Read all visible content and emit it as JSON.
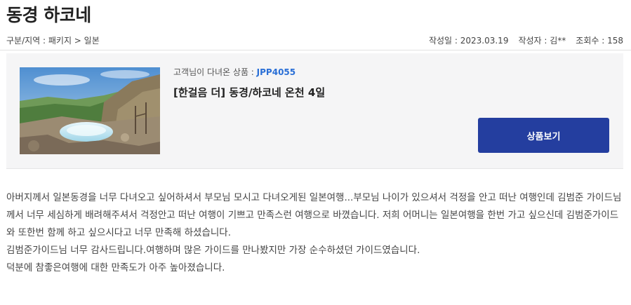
{
  "title": "동경 하코네",
  "meta": {
    "category": "구분/지역 : 패키지 > 일본",
    "date": "작성일 : 2023.03.19",
    "author": "작성자 : 김**",
    "views": "조회수 : 158"
  },
  "product": {
    "visited_label": "고객님이 다녀온 상품 : ",
    "code": "JPP4055",
    "name": "[한걸음 더] 동경/하코네 온천 4일",
    "button_label": "상품보기",
    "image_icon": "hot-spring-landscape-photo",
    "button_color": "#243e9f",
    "code_color": "#2a6fd6"
  },
  "review": {
    "paragraphs": [
      "아버지께서 일본동경을 너무 다녀오고 싶어하셔서 부모님 모시고 다녀오게된 일본여행...부모님 나이가 있으셔서 걱정을 안고 떠난 여행인데 김범준 가이드님께서 너무 세심하게 배려해주셔서 걱정안고 떠난 여행이 기쁘고 만족스런 여행으로 바꼈습니다. 저희 어머니는 일본여행을 한번 가고 싶으신데 김범준가이드와 또한번 함께 하고 싶으시다고 너무 만족해 하셨습니다.",
      "김범준가이드님 너무 감사드립니다.여행하며 많은 가이드를 만나봤지만 가장 순수하셨던 가이드였습니다.",
      "덕분에 참좋은여행에 대한 만족도가 아주 높아졌습니다."
    ]
  }
}
